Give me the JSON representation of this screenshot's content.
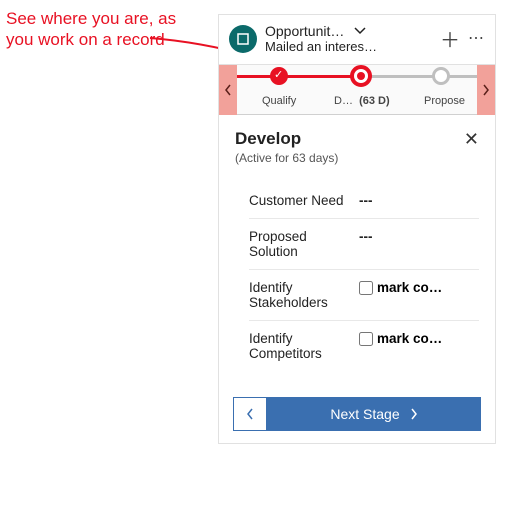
{
  "annotation": "See where you are, as you work on a record",
  "header": {
    "title": "Opportunit…",
    "subtitle": "Mailed an interes…"
  },
  "stages": {
    "s1": {
      "label": "Qualify"
    },
    "s2": {
      "label": "D…",
      "days": "(63 D)"
    },
    "s3": {
      "label": "Propose"
    }
  },
  "popup": {
    "title": "Develop",
    "subtitle": "(Active for 63 days)",
    "fields": {
      "customerNeed": {
        "label": "Customer Need",
        "value": "---"
      },
      "proposedSolution": {
        "label": "Proposed Solution",
        "value": "---"
      },
      "identifyStakeholders": {
        "label": "Identify Stakeholders",
        "check_label": "mark co…"
      },
      "identifyCompetitors": {
        "label": "Identify Competitors",
        "check_label": "mark co…"
      }
    },
    "next_label": "Next Stage"
  }
}
